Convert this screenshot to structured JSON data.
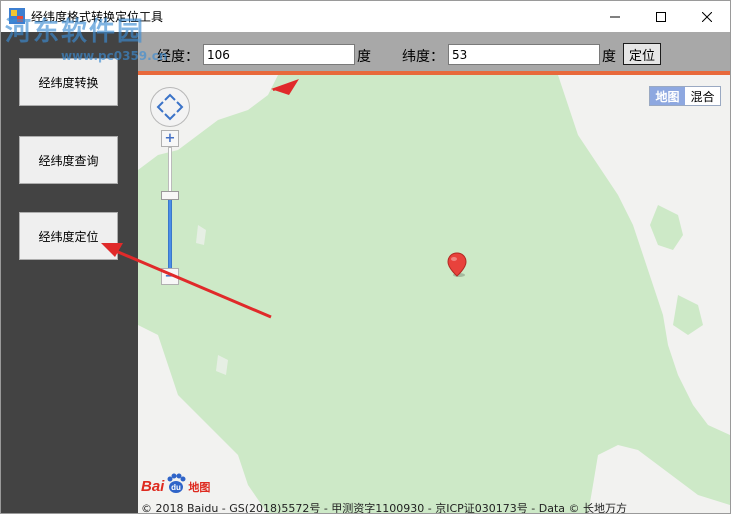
{
  "window": {
    "title": "经纬度格式转换定位工具",
    "watermark": "河东软件园",
    "watermark_url": "www.pc0359.cn"
  },
  "sidebar": {
    "buttons": [
      {
        "label": "经纬度转换"
      },
      {
        "label": "经纬度查询"
      },
      {
        "label": "经纬度定位"
      }
    ]
  },
  "toolbar": {
    "longitude_label": "经度：",
    "longitude_value": "106",
    "longitude_unit": "度",
    "latitude_label": "纬度：",
    "latitude_value": "53",
    "latitude_unit": "度",
    "locate_label": "定位"
  },
  "map": {
    "map_types": [
      "地图",
      "混合"
    ],
    "zoom_in": "+",
    "zoom_out": "−",
    "logo_text": "Bai",
    "logo_du": "du",
    "logo_ditu": "地图",
    "copyright": "© 2018 Baidu - GS(2018)5572号 - 甲测资字1100930 - 京ICP证030173号 - Data © 长地万方"
  },
  "colors": {
    "accent_orange": "#e8693b",
    "sidebar_bg": "#434343",
    "map_green": "#cde9c7",
    "pin_red": "#e8423c",
    "annotation_arrow": "#e02a2a"
  }
}
